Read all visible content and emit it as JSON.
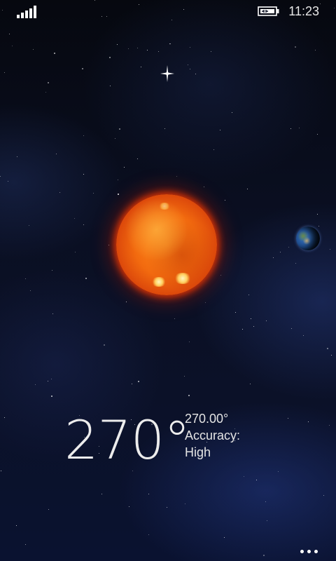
{
  "status_bar": {
    "time": "11:23",
    "signal_icon": "signal-strength-icon",
    "battery_icon": "battery-charging-icon"
  },
  "scene": {
    "sun_icon": "sun-icon",
    "earth_icon": "earth-icon",
    "star_icon": "sparkle-star-icon"
  },
  "readout": {
    "heading": "270°",
    "precise_heading": "270.00°",
    "accuracy_label": "Accuracy:",
    "accuracy_value": "High"
  },
  "app_bar": {
    "more_icon": "ellipsis-icon"
  },
  "colors": {
    "sun": "#f26a0f",
    "sun_glow": "#ff3c00",
    "text": "#ececec",
    "background": "#0a0f22"
  }
}
